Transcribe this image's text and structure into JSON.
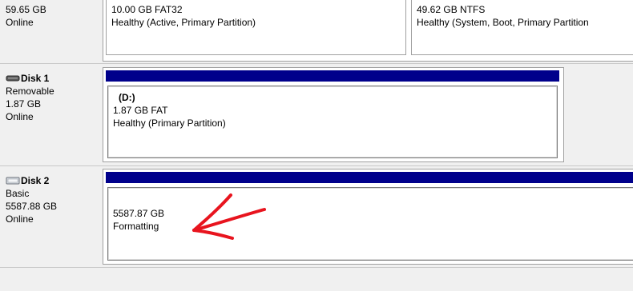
{
  "disk0": {
    "size": "59.65 GB",
    "status": "Online",
    "partitions": [
      {
        "size_fs": "10.00 GB FAT32",
        "health": "Healthy (Active, Primary Partition)"
      },
      {
        "size_fs": "49.62 GB NTFS",
        "health": "Healthy (System, Boot, Primary Partition"
      }
    ]
  },
  "disk1": {
    "name": "Disk 1",
    "type": "Removable",
    "size": "1.87 GB",
    "status": "Online",
    "partition": {
      "label": "(D:)",
      "size_fs": "1.87 GB FAT",
      "health": "Healthy (Primary Partition)"
    }
  },
  "disk2": {
    "name": "Disk 2",
    "type": "Basic",
    "size": "5587.88 GB",
    "status": "Online",
    "partition": {
      "size": "5587.87 GB",
      "status": "Formatting"
    }
  },
  "colors": {
    "partition_bar": "#00008b",
    "arrow": "#e8141e",
    "background": "#f0f0f0"
  },
  "icons": {
    "disk1_icon": "removable-drive-icon",
    "disk2_icon": "hard-drive-icon",
    "annotation": "red-arrow-annotation"
  }
}
